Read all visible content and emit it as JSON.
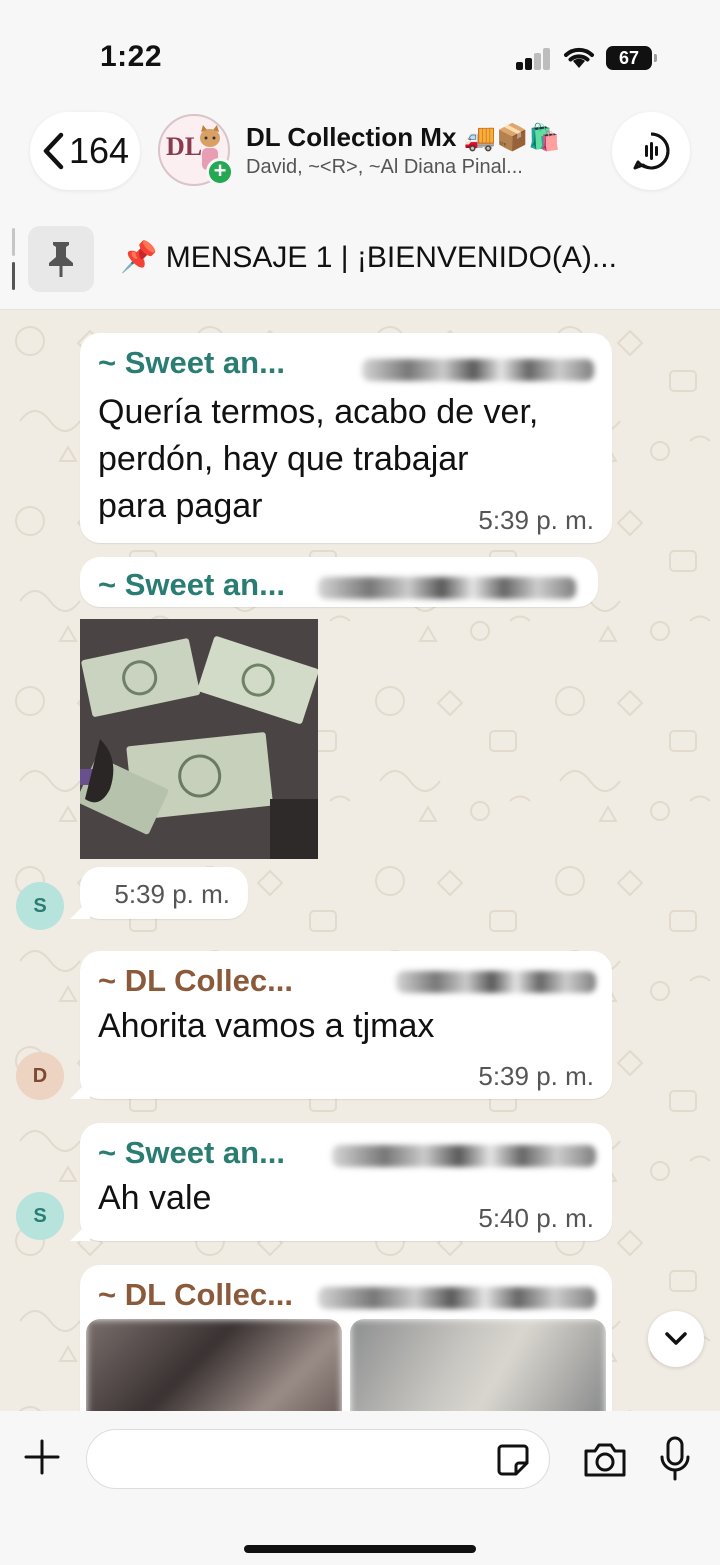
{
  "status_bar": {
    "time": "1:22",
    "battery": "67"
  },
  "header": {
    "back_count": "164",
    "group_name": "DL Collection Mx 🚚📦🛍️",
    "members": "David, ~<R>, ~Al Diana Pinal...",
    "avatar_monogram": "DL"
  },
  "pinned": {
    "emoji": "📌",
    "text": "MENSAJE 1 | ¡BIENVENIDO(A)..."
  },
  "messages": [
    {
      "sender": "~ Sweet an...",
      "text_lines": [
        "Quería termos, acabo de ver,",
        "perdón, hay que trabajar",
        "para pagar"
      ],
      "time": "5:39 p. m."
    },
    {
      "sender": "~ Sweet an...",
      "image": "dollar bills photo",
      "time": "5:39 p. m.",
      "avatar": "S"
    },
    {
      "sender": "~ DL Collec...",
      "text_lines": [
        "Ahorita vamos a tjmax"
      ],
      "time": "5:39 p. m.",
      "avatar": "D"
    },
    {
      "sender": "~ Sweet an...",
      "text_lines": [
        "Ah vale"
      ],
      "time": "5:40 p. m.",
      "avatar": "S"
    },
    {
      "sender": "~ DL Collec...",
      "image": "two blurred photos"
    }
  ],
  "input": {
    "placeholder": ""
  },
  "colors": {
    "teal_sender": "#2a7d72",
    "brown_sender": "#8a5a3b",
    "chat_background": "#f0ebe3",
    "add_badge": "#25a853"
  },
  "icons": [
    "back-chevron-icon",
    "voice-chat-icon",
    "pin-icon",
    "plus-icon",
    "sticker-icon",
    "camera-icon",
    "microphone-icon",
    "chevron-down-icon"
  ]
}
